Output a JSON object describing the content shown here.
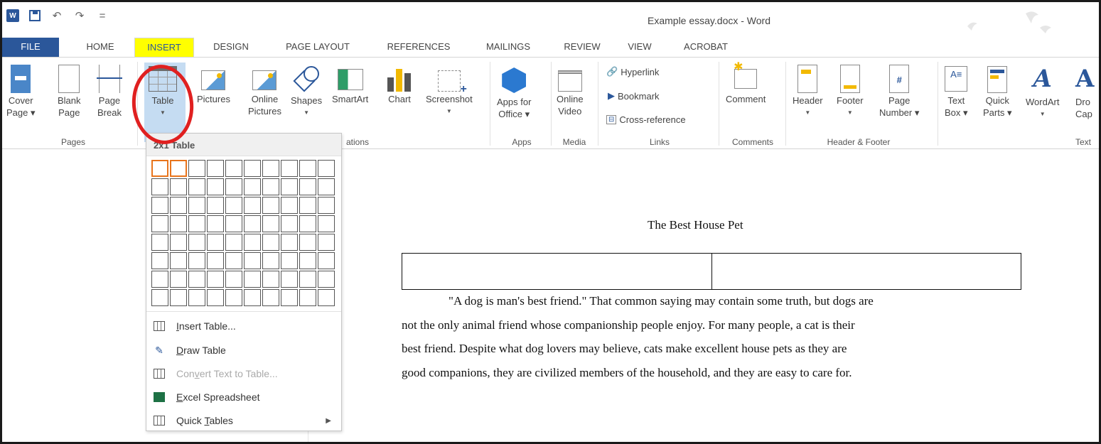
{
  "window": {
    "title": "Example essay.docx - Word"
  },
  "qat": {
    "undo": "↶",
    "redo": "↷",
    "customize": "="
  },
  "tabs": [
    {
      "label": "FILE"
    },
    {
      "label": "HOME"
    },
    {
      "label": "INSERT"
    },
    {
      "label": "DESIGN"
    },
    {
      "label": "PAGE LAYOUT"
    },
    {
      "label": "REFERENCES"
    },
    {
      "label": "MAILINGS"
    },
    {
      "label": "REVIEW"
    },
    {
      "label": "VIEW"
    },
    {
      "label": "ACROBAT"
    }
  ],
  "ribbon": {
    "pages": {
      "cover": "Cover",
      "cover2": "Page ▾",
      "blank": "Blank",
      "blank2": "Page",
      "break": "Page",
      "break2": "Break",
      "label": "Pages"
    },
    "tables": {
      "table": "Table"
    },
    "illustrations": {
      "pictures": "Pictures",
      "online": "Online",
      "online2": "Pictures",
      "shapes": "Shapes",
      "smartart": "SmartArt",
      "chart": "Chart",
      "screenshot": "Screenshot",
      "label": "ations"
    },
    "apps": {
      "apps": "Apps for",
      "apps2": "Office ▾",
      "label": "Apps"
    },
    "media": {
      "video": "Online",
      "video2": "Video",
      "label": "Media"
    },
    "links": {
      "hyperlink": "Hyperlink",
      "bookmark": "Bookmark",
      "crossref": "Cross-reference",
      "label": "Links"
    },
    "comments": {
      "comment": "Comment",
      "label": "Comments"
    },
    "headerfooter": {
      "header": "Header",
      "footer": "Footer",
      "pagenum": "Page",
      "pagenum2": "Number ▾",
      "label": "Header & Footer"
    },
    "text": {
      "textbox": "Text",
      "textbox2": "Box ▾",
      "quick": "Quick",
      "quick2": "Parts ▾",
      "wordart": "WordArt",
      "dropcap": "Dro",
      "dropcap2": "Cap",
      "label": "Text"
    }
  },
  "table_dropdown": {
    "header": "2x1 Table",
    "grid_cols": 10,
    "grid_rows": 8,
    "selected_cols": 2,
    "selected_rows": 1,
    "items": [
      {
        "pre": "",
        "u": "I",
        "post": "nsert Table...",
        "enabled": true,
        "icon": "table-icon"
      },
      {
        "pre": "",
        "u": "D",
        "post": "raw Table",
        "enabled": true,
        "icon": "pencil-icon"
      },
      {
        "pre": "Con",
        "u": "v",
        "post": "ert Text to Table...",
        "enabled": false,
        "icon": "convert-icon"
      },
      {
        "pre": "",
        "u": "E",
        "post": "xcel Spreadsheet",
        "enabled": true,
        "icon": "excel-icon"
      },
      {
        "pre": "Quick ",
        "u": "T",
        "post": "ables",
        "enabled": true,
        "icon": "quick-tables-icon"
      }
    ]
  },
  "document": {
    "title": "The Best House Pet",
    "lines": [
      "\"A dog is man's best friend.\" That common saying may contain some truth, but dogs are",
      "not the only animal friend whose companionship people enjoy. For many people, a cat is their",
      "best friend. Despite what dog lovers may believe, cats make excellent house pets as they are",
      "good companions, they are civilized members of the household, and they are easy to care for."
    ]
  }
}
